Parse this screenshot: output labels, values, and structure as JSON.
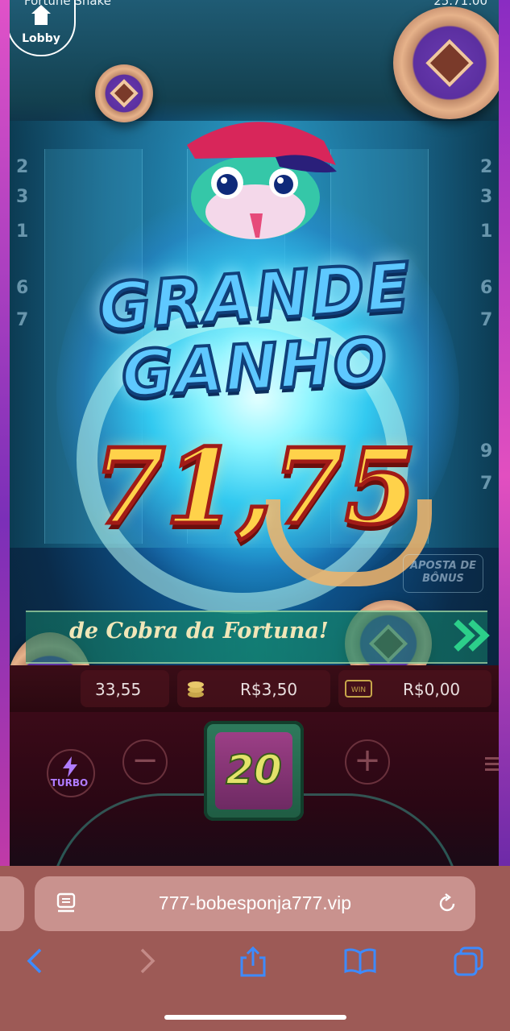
{
  "header": {
    "game_title": "Fortune Snake",
    "balance_partial": "25.71.00",
    "lobby_label": "Lobby"
  },
  "win": {
    "title_line1": "GRANDE",
    "title_line2": "GANHO",
    "amount": "71,75"
  },
  "reels": {
    "left_numbers": [
      "2",
      "3",
      "1",
      "6",
      "7"
    ],
    "right_numbers": [
      "2",
      "3",
      "1",
      "6",
      "7",
      "9",
      "7"
    ]
  },
  "feature": {
    "bonus_bet_label": "APOSTA DE BÔNUS"
  },
  "banner": {
    "text": "de Cobra da Fortuna!"
  },
  "info_bar": {
    "balance": "33,55",
    "bet": "R$3,50",
    "win": "R$0,00"
  },
  "controls": {
    "spin_count": "20",
    "turbo_label": "TURBO",
    "minus_symbol": "−",
    "plus_symbol": "+"
  },
  "browser": {
    "url": "777-bobesponja777.vip",
    "icons": [
      "page-menu-icon",
      "reload-icon",
      "back-icon",
      "forward-icon",
      "share-icon",
      "bookmarks-icon",
      "tabs-icon"
    ]
  },
  "colors": {
    "win_amount": "#ffd24a",
    "title_blue": "#5ec8ff",
    "browser_bar": "#9d5a56"
  }
}
